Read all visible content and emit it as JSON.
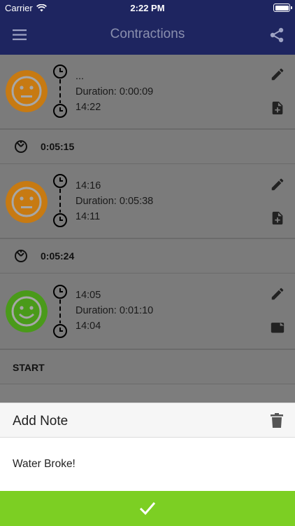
{
  "status_bar": {
    "carrier": "Carrier",
    "time": "2:22 PM"
  },
  "app_bar": {
    "title": "Contractions"
  },
  "contractions": [
    {
      "end_time": "...",
      "duration": "Duration: 0:00:09",
      "start_time": "14:22",
      "face": "neutral",
      "face_color": "#c77a12",
      "note_icon": "note-add-icon"
    },
    {
      "end_time": "14:16",
      "duration": "Duration: 0:05:38",
      "start_time": "14:11",
      "face": "neutral",
      "face_color": "#c77a12",
      "note_icon": "note-add-icon"
    },
    {
      "end_time": "14:05",
      "duration": "Duration: 0:01:10",
      "start_time": "14:04",
      "face": "happy",
      "face_color": "#4a9a1a",
      "note_icon": "note-icon"
    }
  ],
  "intervals": [
    "0:05:15",
    "0:05:24"
  ],
  "start_label": "START",
  "sheet": {
    "title": "Add Note",
    "note_value": "Water Broke!"
  },
  "colors": {
    "app_bar": "#1e2560",
    "overlay_gray": "#7b7b7b",
    "confirm": "#7ccf23"
  }
}
